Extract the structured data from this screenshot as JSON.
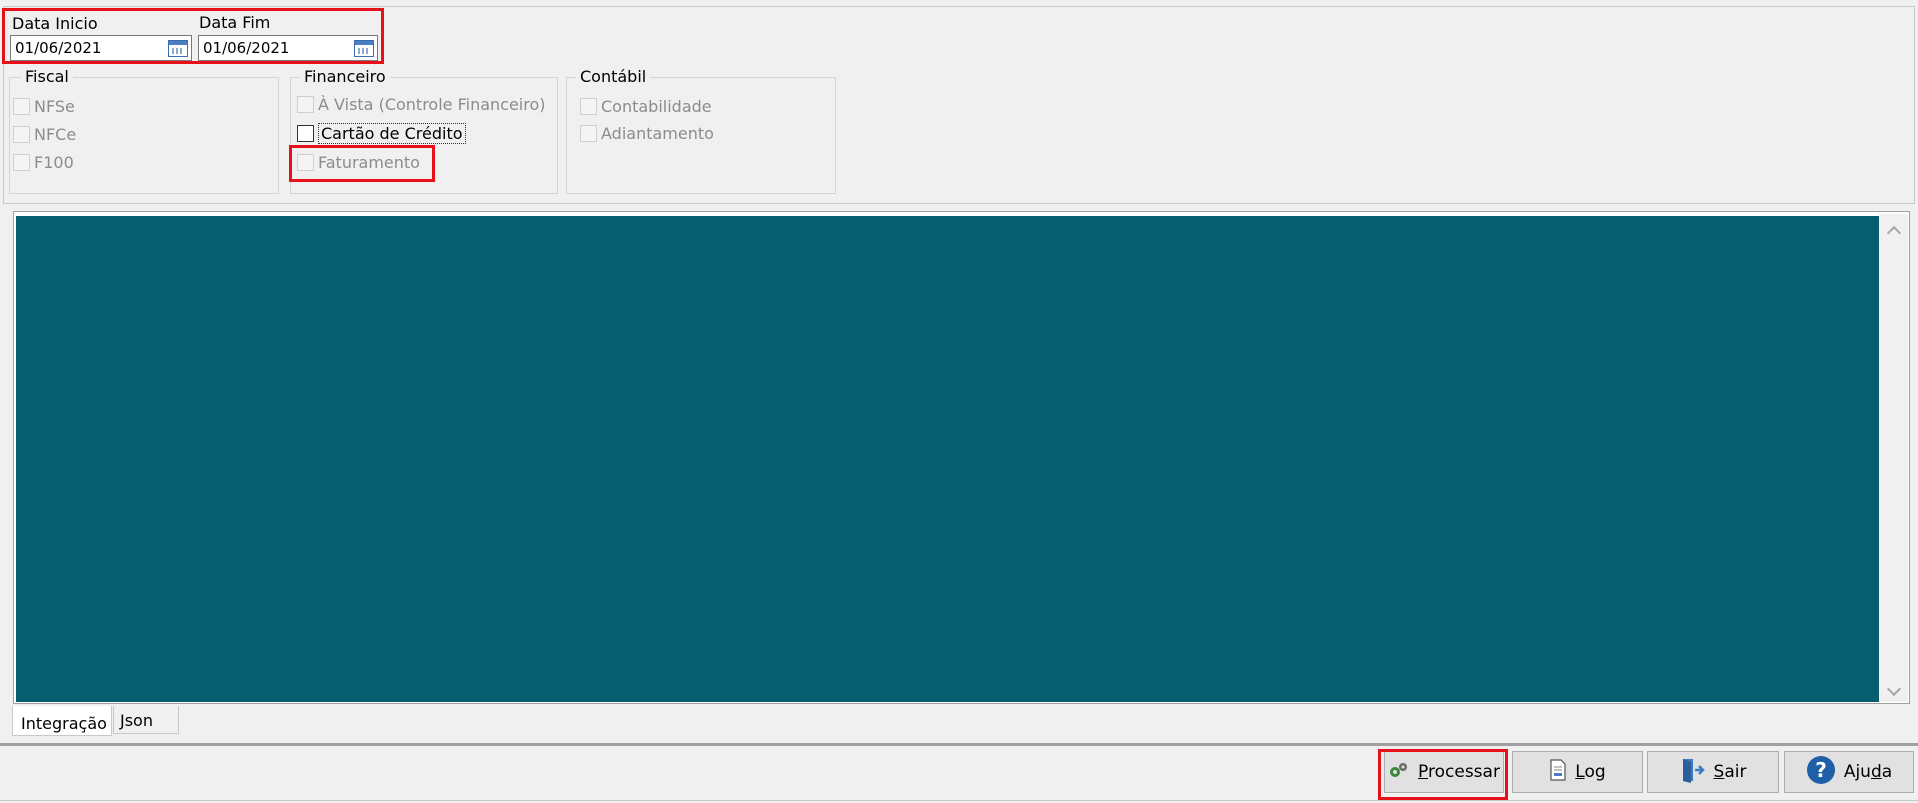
{
  "dates": {
    "start_label": "Data Inicio",
    "start_value": "01/06/2021",
    "end_label": "Data Fim",
    "end_value": "01/06/2021"
  },
  "groups": {
    "fiscal": {
      "title": "Fiscal",
      "items": [
        {
          "label": "NFSe",
          "checked": false,
          "enabled": false
        },
        {
          "label": "NFCe",
          "checked": false,
          "enabled": false
        },
        {
          "label": "F100",
          "checked": false,
          "enabled": false
        }
      ]
    },
    "financeiro": {
      "title": "Financeiro",
      "items": [
        {
          "label": "À Vista (Controle Financeiro)",
          "checked": false,
          "enabled": false
        },
        {
          "label": "Cartão de Crédito",
          "checked": false,
          "enabled": true
        },
        {
          "label": "Faturamento",
          "checked": false,
          "enabled": false
        }
      ]
    },
    "contabil": {
      "title": "Contábil",
      "items": [
        {
          "label": "Contabilidade",
          "checked": false,
          "enabled": false
        },
        {
          "label": "Adiantamento",
          "checked": false,
          "enabled": false
        }
      ]
    }
  },
  "tabs": [
    {
      "label": "Integração",
      "active": true
    },
    {
      "label": "Json",
      "active": false
    }
  ],
  "buttons": {
    "processar": {
      "pre": "",
      "under": "P",
      "post": "rocessar"
    },
    "log": {
      "pre": "",
      "under": "L",
      "post": "og"
    },
    "sair": {
      "pre": "",
      "under": "S",
      "post": "air"
    },
    "ajuda": {
      "pre": "Aju",
      "under": "d",
      "post": "a"
    }
  },
  "colors": {
    "panel": "#075e6e",
    "highlight": "#e8101a"
  }
}
